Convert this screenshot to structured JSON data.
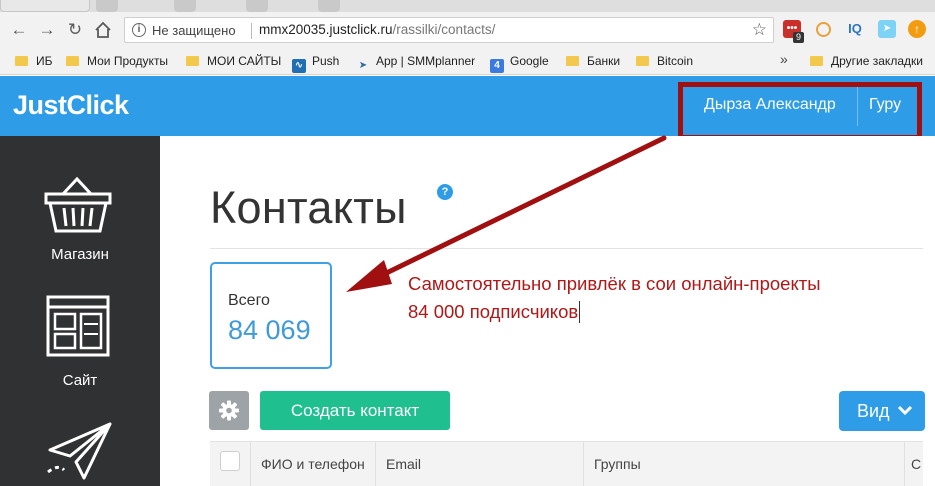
{
  "browser": {
    "address_security": "Не защищено",
    "url_host": "mmx20035.justclick.ru",
    "url_path": "/rassilki/contacts/",
    "extension_badge": "9",
    "extension_iq": "IQ",
    "bookmarks": [
      {
        "label": "ИБ",
        "icon": "folder-icon"
      },
      {
        "label": "Мои Продукты",
        "icon": "folder-icon"
      },
      {
        "label": "МОИ САЙТЫ",
        "icon": "folder-icon"
      },
      {
        "label": "Push",
        "icon": "pulse-icon"
      },
      {
        "label": "App | SMMplanner",
        "icon": "paper-plane-icon"
      },
      {
        "label": "Google",
        "icon": "google-icon"
      },
      {
        "label": "Банки",
        "icon": "folder-icon"
      },
      {
        "label": "Bitcoin",
        "icon": "folder-icon"
      }
    ],
    "bookmarks_overflow": "»",
    "other_bookmarks": "Другие закладки",
    "google_icon_glyph": "4"
  },
  "header": {
    "logo": "JustClick",
    "user_name": "Дырза Александр",
    "user_level": "Гуру"
  },
  "sidebar": {
    "items": [
      {
        "label": "Магазин",
        "icon": "basket-icon"
      },
      {
        "label": "Сайт",
        "icon": "website-layout-icon"
      },
      {
        "label": "",
        "icon": "paper-plane-icon"
      }
    ]
  },
  "main": {
    "title": "Контакты",
    "help_glyph": "?",
    "stat_label": "Всего",
    "stat_value": "84 069",
    "create_button": "Создать контакт",
    "view_button": "Вид",
    "table_columns": [
      "ФИО и телефон",
      "Email",
      "Группы",
      "С"
    ]
  },
  "annotation": {
    "line1": "Самостоятельно привлёк в сои онлайн-проекты",
    "line2": "84 000 подписчиков",
    "color": "#b01818"
  },
  "colors": {
    "brand_blue": "#2e9ce6",
    "sidebar_dark": "#303133",
    "create_green": "#1fbf8f",
    "highlight_red": "#a01010"
  }
}
